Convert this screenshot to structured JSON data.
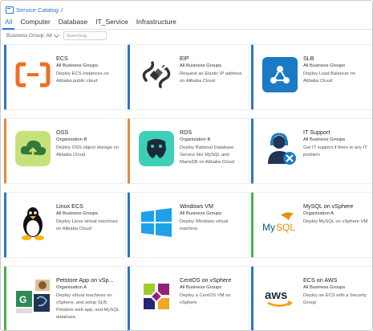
{
  "breadcrumb": {
    "label": "Service Catalog",
    "separator": "/"
  },
  "tabs": [
    {
      "label": "All",
      "active": true
    },
    {
      "label": "Computer",
      "active": false
    },
    {
      "label": "Database",
      "active": false
    },
    {
      "label": "IT_Service",
      "active": false
    },
    {
      "label": "Infrastructure",
      "active": false
    }
  ],
  "filter": {
    "group_label": "Business Group: All",
    "search_placeholder": "Searching..."
  },
  "colors": {
    "accent": "#2f74c9",
    "blue_stripe": "#2f74c9",
    "orange_stripe": "#e38a3a",
    "green_stripe": "#4caf50"
  },
  "cards": [
    {
      "title": "ECS",
      "group": "All Business Groups",
      "desc": "Deploy ECS instances on Alibaba public cloud",
      "icon": "alibaba-cloud-icon",
      "stripe": "blue"
    },
    {
      "title": "EIP",
      "group": "All Business Groups",
      "desc": "Request an Elastic IP address on Alibaba Cloud",
      "icon": "cable-plug-icon",
      "stripe": "blue"
    },
    {
      "title": "SLB",
      "group": "All Business Groups",
      "desc": "Deploy Load Balancer on Alibaba Cloud",
      "icon": "load-balancer-icon",
      "stripe": "blue"
    },
    {
      "title": "OSS",
      "group": "Organization B",
      "desc": "Deploy OSS object storage on Alibaba Cloud",
      "icon": "oss-cloud-icon",
      "stripe": "orange"
    },
    {
      "title": "RDS",
      "group": "Organization B",
      "desc": "Deploy Rational Database Service like MySQL and MariaDB on Alibaba Cloud",
      "icon": "rds-database-icon",
      "stripe": "orange"
    },
    {
      "title": "IT Support",
      "group": "All Business Groups",
      "desc": "Get IT support if there is any IT problem",
      "icon": "it-support-icon",
      "stripe": "blue"
    },
    {
      "title": "Linux ECS",
      "group": "All Business Groups",
      "desc": "Deploy Linux virtual machines on Alibaba Cloud",
      "icon": "linux-tux-icon",
      "stripe": "blue"
    },
    {
      "title": "Windows VM",
      "group": "All Business Groups",
      "desc": "Deploy Windows virtual machine.",
      "icon": "windows-icon",
      "stripe": "blue"
    },
    {
      "title": "MySQL on vSphere",
      "group": "Organization A",
      "desc": "Deploy MySQL on vSphere VM",
      "icon": "mysql-icon",
      "stripe": "green"
    },
    {
      "title": "Petstore App on vSp...",
      "group": "Organization A",
      "desc": "Deploy virtual machines on vSphere, and setup SLB, Petstore web app, and MySQL database.",
      "icon": "petstore-app-icon",
      "stripe": "green"
    },
    {
      "title": "CentOS on vSphere",
      "group": "All Business Groups",
      "desc": "Deploy a CentOS VM on vSphere",
      "icon": "centos-icon",
      "stripe": "blue"
    },
    {
      "title": "ECS on AWS",
      "group": "All Business Groups",
      "desc": "Deploy an ECS with a Security Group",
      "icon": "aws-icon",
      "stripe": "blue"
    }
  ]
}
